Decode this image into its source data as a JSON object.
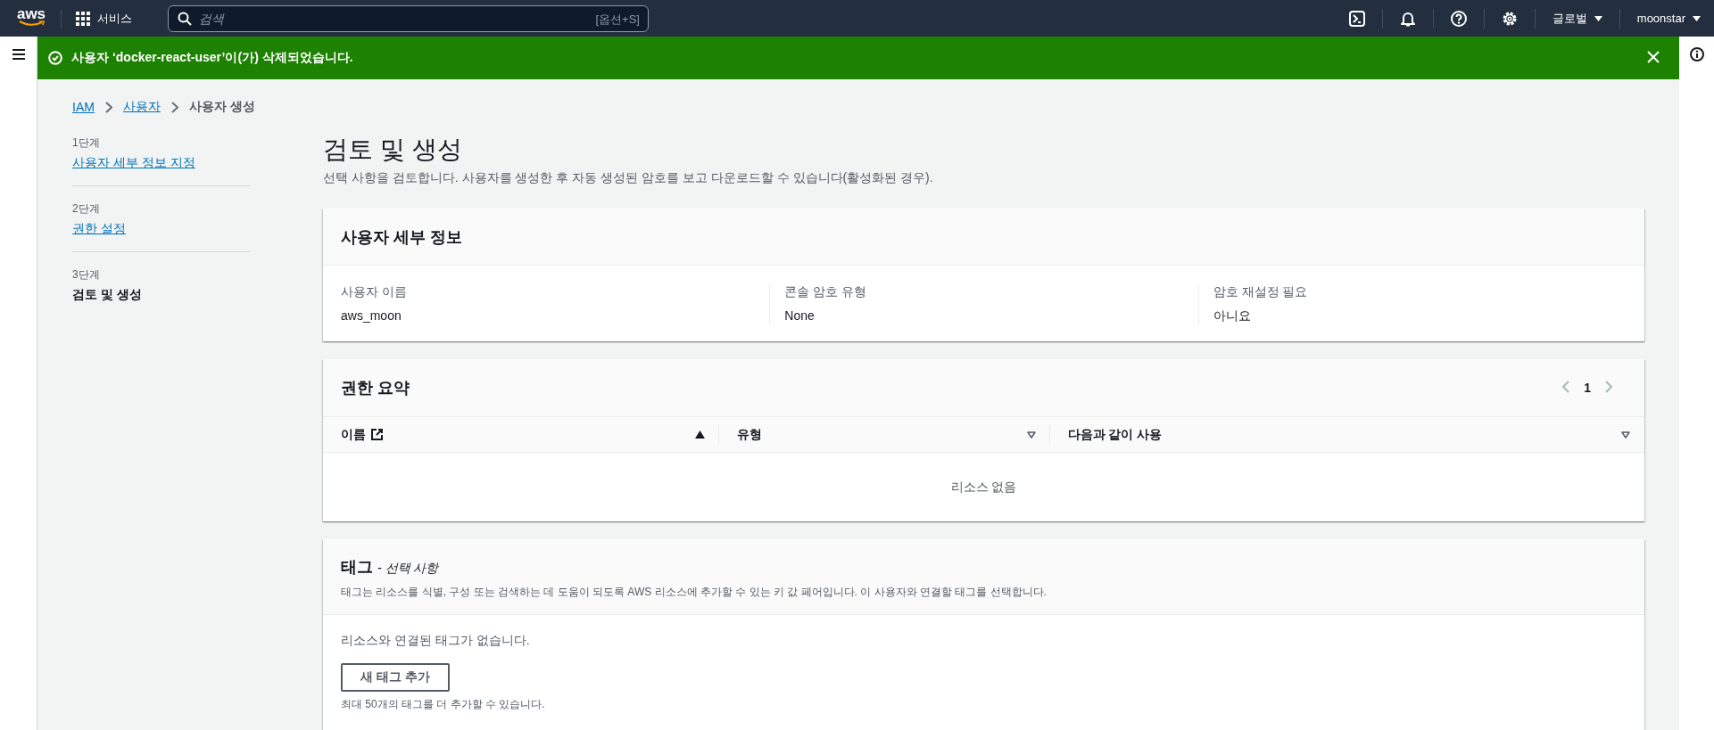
{
  "top_nav": {
    "logo": "aws",
    "services": "서비스",
    "search": {
      "placeholder": "검색",
      "shortcut": "[옵션+S]"
    },
    "region": "글로벌",
    "user": "moonstar"
  },
  "flash": {
    "success": true,
    "message": "사용자 ‘docker-react-user’이(가) 삭제되었습니다."
  },
  "breadcrumbs": [
    {
      "label": "IAM",
      "kind": "link"
    },
    {
      "label": "사용자",
      "kind": "link"
    },
    {
      "label": "사용자 생성",
      "kind": "current"
    }
  ],
  "steps": [
    {
      "number": "1단계",
      "title": "사용자 세부 정보 지정",
      "selected": false
    },
    {
      "number": "2단계",
      "title": "권한 설정",
      "selected": false
    },
    {
      "number": "3단계",
      "title": "검토 및 생성",
      "selected": true
    }
  ],
  "page": {
    "title": "검토 및 생성",
    "description": "선택 사항을 검토합니다. 사용자를 생성한 후 자동 생성된 암호를 보고 다운로드할 수 있습니다(활성화된 경우)."
  },
  "user_details": {
    "title": "사용자 세부 정보",
    "fields": [
      {
        "label": "사용자 이름",
        "value": "aws_moon"
      },
      {
        "label": "콘솔 암호 유형",
        "value": "None"
      },
      {
        "label": "암호 재설정 필요",
        "value": "아니요"
      }
    ]
  },
  "permissions": {
    "title": "권한 요약",
    "page": "1",
    "columns": [
      {
        "label": "이름",
        "external_link": true,
        "sorted": true
      },
      {
        "label": "유형",
        "external_link": false,
        "sorted": false
      },
      {
        "label": "다음과 같이 사용",
        "external_link": false,
        "sorted": false
      }
    ],
    "empty": "리소스 없음"
  },
  "tags": {
    "title": "태그",
    "optional": "- 선택 사항",
    "description": "태그는 리소스를 식별, 구성 또는 검색하는 데 도움이 되도록 AWS 리소스에 추가할 수 있는 키 값 페어입니다. 이 사용자와 연결할 태그를 선택합니다.",
    "empty": "리소스와 연결된 태그가 없습니다.",
    "button": "새 태그 추가",
    "hint": "최대 50개의 태그를 더 추가할 수 있습니다."
  }
}
